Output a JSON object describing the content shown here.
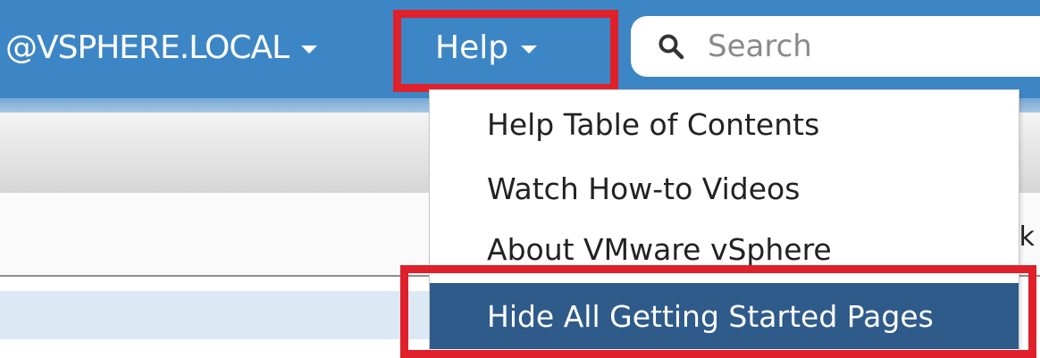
{
  "header": {
    "user_label": "@VSPHERE.LOCAL",
    "help_label": "Help",
    "search": {
      "placeholder": "Search"
    }
  },
  "page": {
    "row_trailing_text": "k"
  },
  "help_dropdown": {
    "items": [
      {
        "label": "Help Table of Contents"
      },
      {
        "label": "Watch How-to Videos"
      },
      {
        "label": "About VMware vSphere"
      },
      {
        "label": "Hide All Getting Started Pages",
        "highlighted": true
      }
    ]
  },
  "colors": {
    "header_blue": "#3d86c6",
    "highlight_red": "#e0202a",
    "selected_item": "#2f5b8b"
  }
}
